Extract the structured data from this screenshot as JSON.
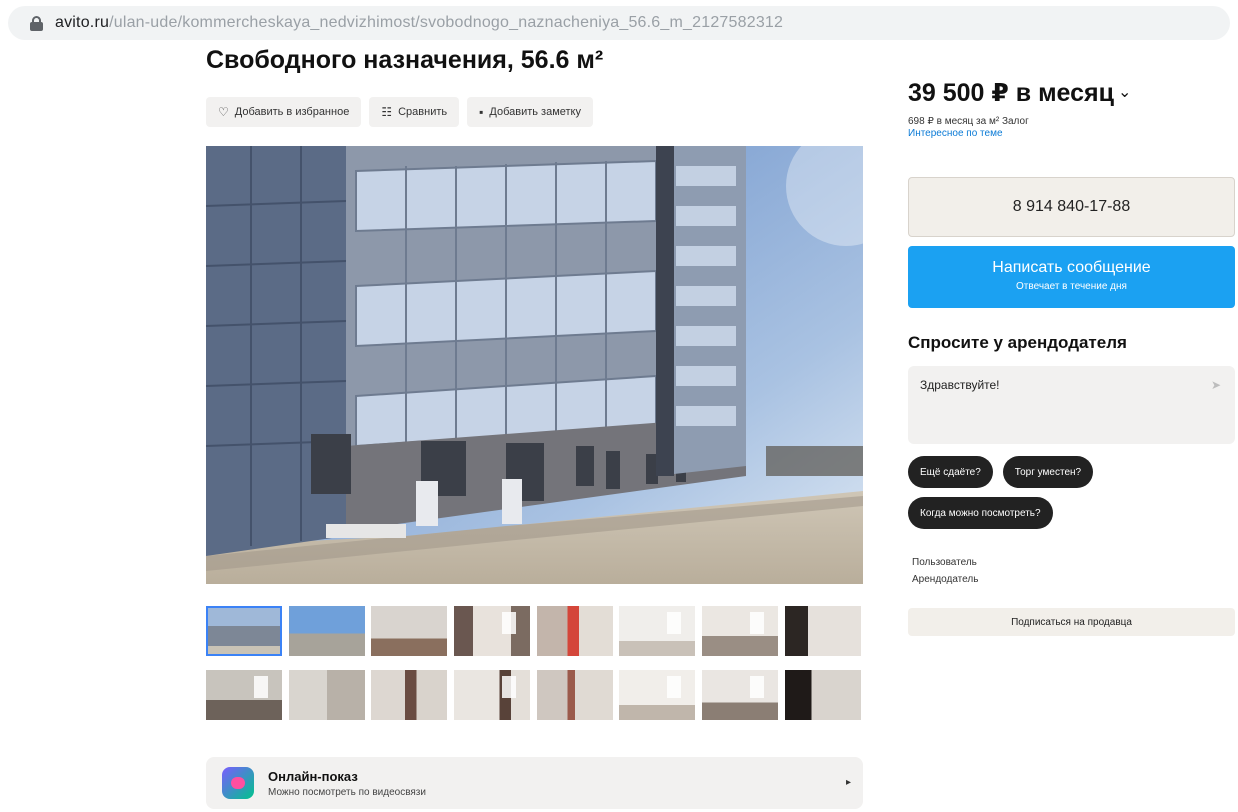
{
  "browser": {
    "url_host": "avito.ru",
    "url_path": "/ulan-ude/kommercheskaya_nedvizhimost/svobodnogo_naznacheniya_56.6_m_2127582312"
  },
  "listing": {
    "title": "Свободного назначения, 56.6 м²",
    "actions": [
      {
        "icon": "heart-icon",
        "label": "Добавить в избранное"
      },
      {
        "icon": "compare-icon",
        "label": "Сравнить"
      },
      {
        "icon": "note-icon",
        "label": "Добавить заметку"
      }
    ],
    "online_viewing": {
      "title": "Онлайн-показ",
      "subtitle": "Можно посмотреть по видеосвязи"
    }
  },
  "sidebar": {
    "price": "39 500 ₽ в месяц",
    "price_sub_line1": "698 ₽ в месяц за м² Залог",
    "price_sub_link": "Интересное по теме",
    "phone": "8 914 840-17-88",
    "message_button": "Написать сообщение",
    "message_sub": "Отвечает в течение дня",
    "ask_title": "Спросите у арендодателя",
    "ask_placeholder": "Здравствуйте!",
    "quick_questions": [
      "Ещё сдаёте?",
      "Торг уместен?",
      "Когда можно посмотреть?"
    ],
    "user_label": "Пользователь",
    "user_role": "Арендодатель",
    "subscribe_label": "Подписаться на продавца"
  }
}
